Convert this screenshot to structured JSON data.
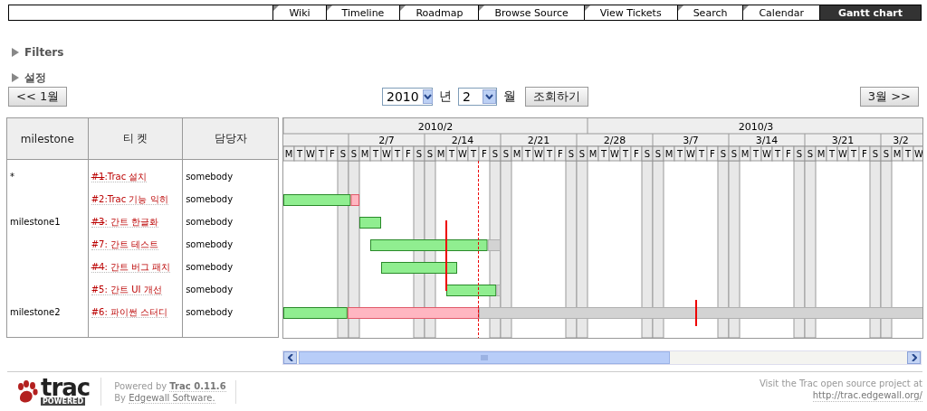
{
  "nav": {
    "tabs": [
      {
        "label": "Wiki",
        "selected": false
      },
      {
        "label": "Timeline",
        "selected": false
      },
      {
        "label": "Roadmap",
        "selected": false
      },
      {
        "label": "Browse Source",
        "selected": false
      },
      {
        "label": "View Tickets",
        "selected": false
      },
      {
        "label": "Search",
        "selected": false
      },
      {
        "label": "Calendar",
        "selected": false
      },
      {
        "label": "Gantt chart",
        "selected": true
      }
    ]
  },
  "sections": [
    {
      "label": "Filters",
      "expanded": false
    },
    {
      "label": "설정",
      "expanded": false
    }
  ],
  "controls": {
    "prev": "<< 1월",
    "year": "2010",
    "year_unit": "년",
    "month": "2",
    "month_unit": "월",
    "submit": "조회하기",
    "next": "3월 >>"
  },
  "table": {
    "columns": [
      "milestone",
      "티 켓",
      "담당자"
    ],
    "groups": [
      {
        "milestone": "*",
        "tickets": [
          {
            "number": "#1",
            "title": ":Trac 설치",
            "closed": true,
            "owner": "somebody"
          },
          {
            "number": "#2",
            "title": ":Trac 기능 익히",
            "closed": false,
            "owner": "somebody"
          }
        ]
      },
      {
        "milestone": "milestone1",
        "tickets": [
          {
            "number": "#3",
            "title": ": 간트 한글화",
            "closed": true,
            "owner": "somebody"
          },
          {
            "number": "#7",
            "title": ": 간트 테스트",
            "closed": false,
            "owner": "somebody"
          },
          {
            "number": "#4",
            "title": ": 간트 버그 패치",
            "closed": true,
            "owner": "somebody"
          },
          {
            "number": "#5",
            "title": ": 간트 UI 개선",
            "closed": false,
            "owner": "somebody"
          }
        ]
      },
      {
        "milestone": "milestone2",
        "tickets": [
          {
            "number": "#6",
            "title": ": 파이썬 스터디",
            "closed": false,
            "owner": "somebody"
          }
        ]
      }
    ]
  },
  "chart": {
    "months": [
      "2010/2",
      "2010/3"
    ],
    "weeks": [
      "2/7",
      "2/14",
      "2/21",
      "2/28",
      "3/7",
      "3/14",
      "3/21",
      "3/2"
    ],
    "days": [
      {
        "letter": "M",
        "weekend": false
      },
      {
        "letter": "T",
        "weekend": false
      },
      {
        "letter": "W",
        "weekend": false
      },
      {
        "letter": "T",
        "weekend": false
      },
      {
        "letter": "F",
        "weekend": false
      },
      {
        "letter": "S",
        "weekend": true
      },
      {
        "letter": "S",
        "weekend": true
      },
      {
        "letter": "M",
        "weekend": false
      },
      {
        "letter": "T",
        "weekend": false
      },
      {
        "letter": "W",
        "weekend": false
      },
      {
        "letter": "T",
        "weekend": false
      },
      {
        "letter": "F",
        "weekend": false
      },
      {
        "letter": "S",
        "weekend": true
      },
      {
        "letter": "S",
        "weekend": true
      },
      {
        "letter": "M",
        "weekend": false
      },
      {
        "letter": "T",
        "weekend": false
      },
      {
        "letter": "W",
        "weekend": false
      },
      {
        "letter": "T",
        "weekend": false
      },
      {
        "letter": "F",
        "weekend": false
      },
      {
        "letter": "S",
        "weekend": true
      },
      {
        "letter": "S",
        "weekend": true
      },
      {
        "letter": "M",
        "weekend": false
      },
      {
        "letter": "T",
        "weekend": false
      },
      {
        "letter": "W",
        "weekend": false
      },
      {
        "letter": "T",
        "weekend": false
      },
      {
        "letter": "F",
        "weekend": false
      },
      {
        "letter": "S",
        "weekend": true
      },
      {
        "letter": "S",
        "weekend": true
      },
      {
        "letter": "M",
        "weekend": false
      },
      {
        "letter": "T",
        "weekend": false
      },
      {
        "letter": "W",
        "weekend": false
      },
      {
        "letter": "T",
        "weekend": false
      },
      {
        "letter": "F",
        "weekend": false
      },
      {
        "letter": "S",
        "weekend": true
      },
      {
        "letter": "S",
        "weekend": true
      },
      {
        "letter": "M",
        "weekend": false
      },
      {
        "letter": "T",
        "weekend": false
      },
      {
        "letter": "W",
        "weekend": false
      },
      {
        "letter": "T",
        "weekend": false
      },
      {
        "letter": "F",
        "weekend": false
      },
      {
        "letter": "S",
        "weekend": true
      },
      {
        "letter": "S",
        "weekend": true
      },
      {
        "letter": "M",
        "weekend": false
      },
      {
        "letter": "T",
        "weekend": false
      },
      {
        "letter": "W",
        "weekend": false
      },
      {
        "letter": "T",
        "weekend": false
      },
      {
        "letter": "F",
        "weekend": false
      },
      {
        "letter": "S",
        "weekend": true
      },
      {
        "letter": "S",
        "weekend": true
      },
      {
        "letter": "M",
        "weekend": false
      },
      {
        "letter": "T",
        "weekend": false
      },
      {
        "letter": "W",
        "weekend": false
      },
      {
        "letter": "T",
        "weekend": false
      },
      {
        "letter": "F",
        "weekend": false
      },
      {
        "letter": "S",
        "weekend": true
      },
      {
        "letter": "S",
        "weekend": true
      },
      {
        "letter": "M",
        "weekend": false
      },
      {
        "letter": "T",
        "weekend": false
      },
      {
        "letter": "W",
        "weekend": false
      }
    ]
  },
  "footer": {
    "logo": {
      "word": "trac",
      "tag": "POWERED"
    },
    "powered": "Powered by",
    "powered_link": "Trac 0.11.6",
    "by": "By",
    "by_link": "Edgewall Software.",
    "visit": "Visit the Trac open source project at",
    "url": "http://trac.edgewall.org/"
  }
}
